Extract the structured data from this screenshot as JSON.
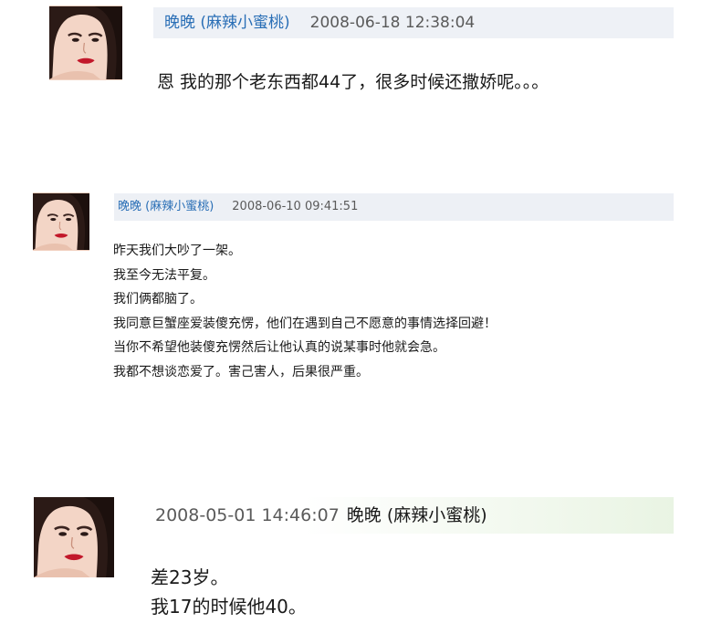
{
  "posts": [
    {
      "author": "晚晚 (麻辣小蜜桃)",
      "datetime": "2008-06-18 12:38:04",
      "lines": [
        "恩 我的那个老东西都44了，很多时候还撒娇呢。。。"
      ]
    },
    {
      "author": "晚晚 (麻辣小蜜桃)",
      "datetime": "2008-06-10 09:41:51",
      "lines": [
        "昨天我们大吵了一架。",
        "我至今无法平复。",
        "我们俩都脑了。",
        "我同意巨蟹座爱装傻充愣，他们在遇到自己不愿意的事情选择回避！",
        "当你不希望他装傻充愣然后让他认真的说某事时他就会急。",
        "我都不想谈恋爱了。害己害人，后果很严重。"
      ]
    },
    {
      "author": "晚晚 (麻辣小蜜桃)",
      "datetime": "2008-05-01 14:46:07",
      "lines": [
        "差23岁。",
        "我17的时候他40。"
      ]
    }
  ],
  "avatar_icon": "woman-portrait-icon",
  "colors": {
    "author": "#2a6fb6",
    "header_bg": "#eef1f6",
    "header_bg_green": "#e9f4e3"
  }
}
